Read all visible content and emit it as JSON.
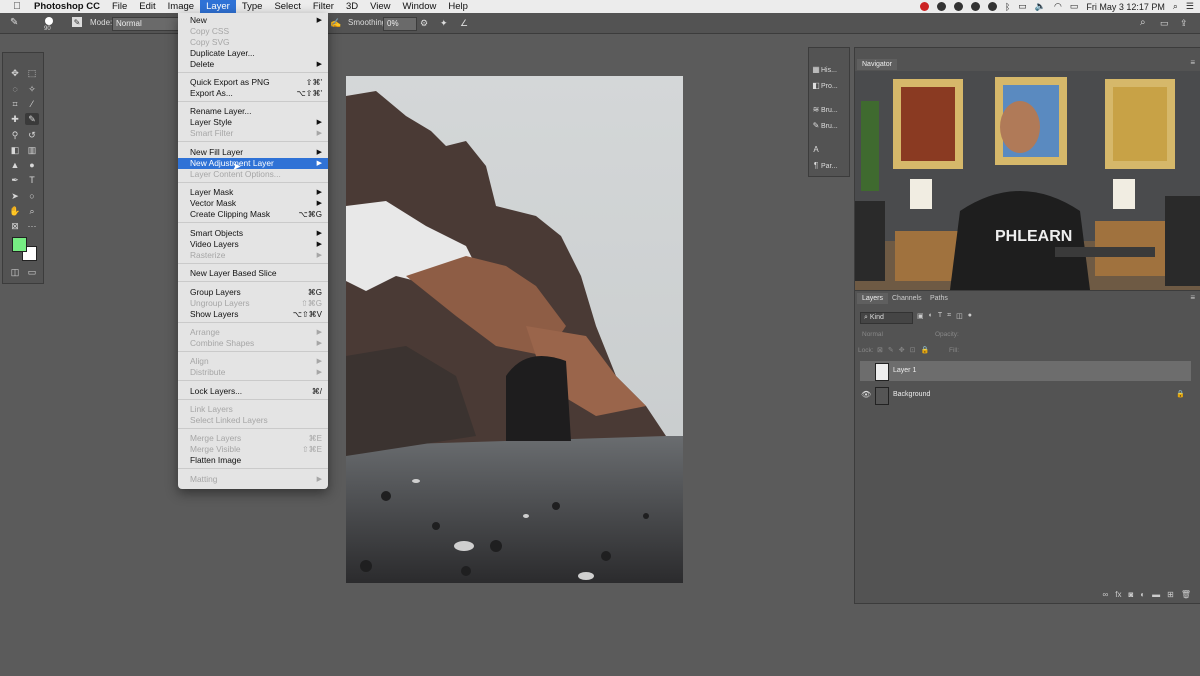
{
  "menubar": {
    "app_name": "Photoshop CC",
    "items": [
      "File",
      "Edit",
      "Image",
      "Layer",
      "Type",
      "Select",
      "Filter",
      "3D",
      "View",
      "Window",
      "Help"
    ],
    "active_item": "Layer",
    "datetime": "Fri May 3  12:17 PM"
  },
  "options_bar": {
    "brush_size": "90",
    "mode_label": "Mode:",
    "mode_value": "Normal",
    "smoothing_label": "Smoothing:",
    "smoothing_value": "0%"
  },
  "layer_menu": {
    "items": [
      {
        "label": "New",
        "shortcut": "",
        "submenu": true,
        "disabled": false
      },
      {
        "label": "Copy CSS",
        "shortcut": "",
        "submenu": false,
        "disabled": true
      },
      {
        "label": "Copy SVG",
        "shortcut": "",
        "submenu": false,
        "disabled": true
      },
      {
        "label": "Duplicate Layer...",
        "shortcut": "",
        "submenu": false,
        "disabled": false
      },
      {
        "label": "Delete",
        "shortcut": "",
        "submenu": true,
        "disabled": false
      },
      {
        "label": "Quick Export as PNG",
        "shortcut": "⇧⌘'",
        "submenu": false,
        "disabled": false
      },
      {
        "label": "Export As...",
        "shortcut": "⌥⇧⌘'",
        "submenu": false,
        "disabled": false
      },
      {
        "label": "Rename Layer...",
        "shortcut": "",
        "submenu": false,
        "disabled": false
      },
      {
        "label": "Layer Style",
        "shortcut": "",
        "submenu": true,
        "disabled": false
      },
      {
        "label": "Smart Filter",
        "shortcut": "",
        "submenu": true,
        "disabled": true
      },
      {
        "label": "New Fill Layer",
        "shortcut": "",
        "submenu": true,
        "disabled": false
      },
      {
        "label": "New Adjustment Layer",
        "shortcut": "",
        "submenu": true,
        "disabled": false,
        "highlighted": true
      },
      {
        "label": "Layer Content Options...",
        "shortcut": "",
        "submenu": false,
        "disabled": true
      },
      {
        "label": "Layer Mask",
        "shortcut": "",
        "submenu": true,
        "disabled": false
      },
      {
        "label": "Vector Mask",
        "shortcut": "",
        "submenu": true,
        "disabled": false
      },
      {
        "label": "Create Clipping Mask",
        "shortcut": "⌥⌘G",
        "submenu": false,
        "disabled": false
      },
      {
        "label": "Smart Objects",
        "shortcut": "",
        "submenu": true,
        "disabled": false
      },
      {
        "label": "Video Layers",
        "shortcut": "",
        "submenu": true,
        "disabled": false
      },
      {
        "label": "Rasterize",
        "shortcut": "",
        "submenu": true,
        "disabled": true
      },
      {
        "label": "New Layer Based Slice",
        "shortcut": "",
        "submenu": false,
        "disabled": false
      },
      {
        "label": "Group Layers",
        "shortcut": "⌘G",
        "submenu": false,
        "disabled": false
      },
      {
        "label": "Ungroup Layers",
        "shortcut": "⇧⌘G",
        "submenu": false,
        "disabled": true
      },
      {
        "label": "Show Layers",
        "shortcut": "⌥⇧⌘V",
        "submenu": false,
        "disabled": false
      },
      {
        "label": "Arrange",
        "shortcut": "",
        "submenu": true,
        "disabled": true
      },
      {
        "label": "Combine Shapes",
        "shortcut": "",
        "submenu": true,
        "disabled": true
      },
      {
        "label": "Align",
        "shortcut": "",
        "submenu": true,
        "disabled": true
      },
      {
        "label": "Distribute",
        "shortcut": "",
        "submenu": true,
        "disabled": true
      },
      {
        "label": "Lock Layers...",
        "shortcut": "⌘/",
        "submenu": false,
        "disabled": false
      },
      {
        "label": "Link Layers",
        "shortcut": "",
        "submenu": false,
        "disabled": true
      },
      {
        "label": "Select Linked Layers",
        "shortcut": "",
        "submenu": false,
        "disabled": true
      },
      {
        "label": "Merge Layers",
        "shortcut": "⌘E",
        "submenu": false,
        "disabled": true
      },
      {
        "label": "Merge Visible",
        "shortcut": "⇧⌘E",
        "submenu": false,
        "disabled": true
      },
      {
        "label": "Flatten Image",
        "shortcut": "",
        "submenu": false,
        "disabled": false
      },
      {
        "label": "Matting",
        "shortcut": "",
        "submenu": true,
        "disabled": true
      }
    ]
  },
  "side_panels": [
    "His...",
    "Pro...",
    "Bru...",
    "Bru...",
    "Par..."
  ],
  "navigator": {
    "tab": "Navigator",
    "video_text": "PHLEARN"
  },
  "layers_panel": {
    "tabs": [
      "Layers",
      "Channels",
      "Paths"
    ],
    "filter_value": "Kind",
    "blend_mode": "Normal",
    "opacity_label": "Opacity:",
    "lock_label": "Lock:",
    "fill_label": "Fill:",
    "layers": [
      {
        "name": "Layer 1",
        "selected": true,
        "visible": false
      },
      {
        "name": "Background",
        "selected": false,
        "visible": true
      }
    ]
  },
  "colors": {
    "foreground": "#76ee83",
    "background": "#ffffff",
    "highlight": "#2f72d6"
  }
}
